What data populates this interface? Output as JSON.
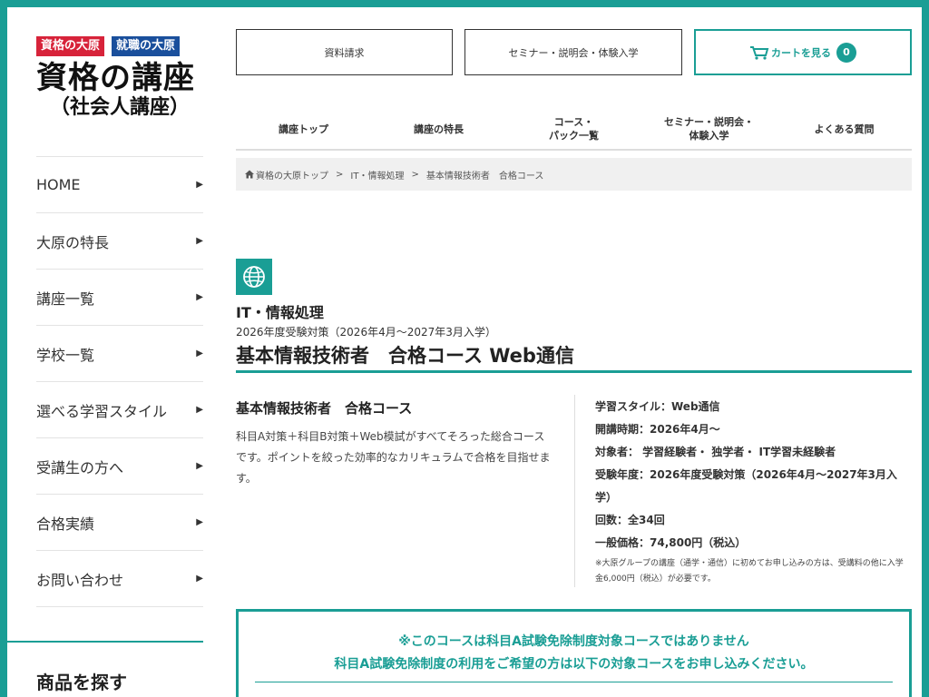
{
  "brand": {
    "badge1": "資格の大原",
    "badge2": "就職の大原",
    "title": "資格の講座",
    "subtitle": "（社会人講座）"
  },
  "sidebar": {
    "items": [
      {
        "label": "HOME"
      },
      {
        "label": "大原の特長"
      },
      {
        "label": "講座一覧"
      },
      {
        "label": "学校一覧"
      },
      {
        "label": "選べる学習スタイル"
      },
      {
        "label": "受講生の方へ"
      },
      {
        "label": "合格実績"
      },
      {
        "label": "お問い合わせ"
      }
    ],
    "search_title": "商品を探す"
  },
  "header": {
    "request_label": "資料請求",
    "seminar_label": "セミナー・説明会・体験入学",
    "cart_label": "カートを見る",
    "cart_count": "0"
  },
  "mainnav": {
    "items": [
      {
        "line1": "講座トップ",
        "line2": ""
      },
      {
        "line1": "講座の特長",
        "line2": ""
      },
      {
        "line1": "コース・",
        "line2": "パック一覧"
      },
      {
        "line1": "セミナー・説明会・",
        "line2": "体験入学"
      },
      {
        "line1": "よくある質問",
        "line2": ""
      }
    ]
  },
  "breadcrumb": {
    "home": "資格の大原トップ",
    "sep": ">",
    "category": "IT・情報処理",
    "current": "基本情報技術者　合格コース"
  },
  "course": {
    "category_name": "IT・情報処理",
    "exam_year": "2026年度受験対策（2026年4月～2027年3月入学）",
    "title": "基本情報技術者　合格コース Web通信",
    "subtitle": "基本情報技術者　合格コース",
    "description": "科目A対策＋科目B対策＋Web模試がすべてそろった総合コースです。ポイントを絞った効率的なカリキュラムで合格を目指せます。",
    "specs": {
      "style": "学習スタイル：Web通信",
      "start": "開講時期：2026年4月～",
      "target": "対象者： 学習経験者・ 独学者・ IT学習未経験者",
      "exam": "受験年度：2026年度受験対策（2026年4月～2027年3月入学）",
      "sessions": "回数：全34回",
      "price": "一般価格：74,800円（税込）",
      "note": "※大原グループの講座（通学・通信）に初めてお申し込みの方は、受講料の他に入学金6,000円（税込）が必要です。"
    }
  },
  "notice": {
    "line1": "※このコースは科目A試験免除制度対象コースではありません",
    "line2": "科目A試験免除制度の利用をご希望の方は以下の対象コースをお申し込みください。"
  },
  "colors": {
    "accent": "#1a9e95",
    "badge_red": "#d7233a",
    "badge_blue": "#1a4f9c"
  }
}
